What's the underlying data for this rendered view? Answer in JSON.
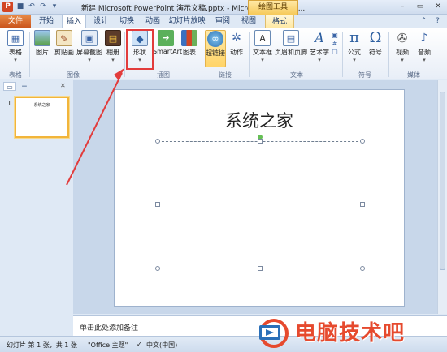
{
  "titlebar": {
    "app_icon": "P",
    "document_title": "新建 Microsoft PowerPoint 演示文稿.pptx - Microsoft PowerPo...",
    "context_tab_header": "绘图工具",
    "qat_icons": [
      "save-icon",
      "undo-icon",
      "redo-icon",
      "customize-icon"
    ],
    "window_controls": [
      "–",
      "▭",
      "✕"
    ]
  },
  "tabs": {
    "file": "文件",
    "items": [
      "开始",
      "插入",
      "设计",
      "切换",
      "动画",
      "幻灯片放映",
      "审阅",
      "视图",
      "格式"
    ],
    "active": "插入"
  },
  "ribbon": {
    "buttons": [
      {
        "label": "表格",
        "icon": "table-icon"
      },
      {
        "label": "图片",
        "icon": "picture-icon"
      },
      {
        "label": "剪贴画",
        "icon": "clipart-icon"
      },
      {
        "label": "屏幕截图",
        "icon": "screenshot-icon"
      },
      {
        "label": "相册",
        "icon": "album-icon"
      },
      {
        "label": "形状",
        "icon": "shapes-icon"
      },
      {
        "label": "SmartArt",
        "icon": "smartart-icon"
      },
      {
        "label": "图表",
        "icon": "chart-icon"
      },
      {
        "label": "超链接",
        "icon": "hyperlink-icon"
      },
      {
        "label": "动作",
        "icon": "action-icon"
      },
      {
        "label": "文本框",
        "icon": "textbox-icon"
      },
      {
        "label": "页眉和页脚",
        "icon": "header-footer-icon"
      },
      {
        "label": "艺术字",
        "icon": "wordart-icon"
      },
      {
        "label": "公式",
        "icon": "equation-icon",
        "glyph": "π"
      },
      {
        "label": "符号",
        "icon": "symbol-icon",
        "glyph": "Ω"
      },
      {
        "label": "视频",
        "icon": "video-icon"
      },
      {
        "label": "音频",
        "icon": "audio-icon"
      }
    ],
    "groups": [
      "表格",
      "图像",
      "插图",
      "链接",
      "文本",
      "符号",
      "媒体"
    ]
  },
  "left_panel": {
    "slide_number": "1",
    "thumbnail_title": "系统之家"
  },
  "slide": {
    "title": "系统之家"
  },
  "notes": {
    "placeholder": "单击此处添加备注"
  },
  "statusbar": {
    "slide_info": "幻灯片 第 1 张，共 1 张",
    "theme": "\"Office 主题\"",
    "language": "中文(中国)"
  },
  "watermark": {
    "text": "电脑技术吧"
  },
  "colors": {
    "file_tab": "#c8521a",
    "highlight": "#e23c3c",
    "watermark": "#e64a2e",
    "ribbon_bg": "#e8eef7"
  }
}
